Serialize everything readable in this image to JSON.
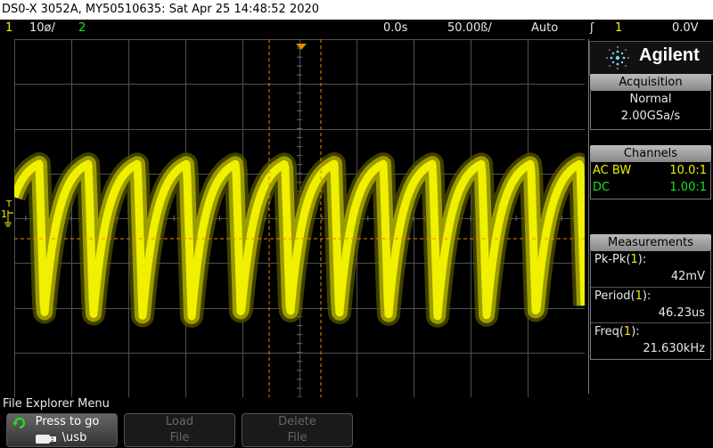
{
  "title": "DS0-X 3052A, MY50510635: Sat Apr 25 14:48:52 2020",
  "status": {
    "ch1_num": "1",
    "ch1_scale": "10ø/",
    "ch2_num": "2",
    "time_pos": "0.0s",
    "time_scale": "50.00ß/",
    "trig_mode": "Auto",
    "trig_icon": "ʃ",
    "trig_src": "1",
    "trig_level": "0.0V"
  },
  "screen": {
    "ch1_label": "1",
    "trig_t": "T",
    "colors": {
      "ch1": "#f0f000",
      "ch2": "#19e619",
      "cursor": "#e68a00",
      "grid": "#505050"
    }
  },
  "side": {
    "brand": "Agilent",
    "acquisition": {
      "header": "Acquisition",
      "mode": "Normal",
      "rate": "2.00GSa/s"
    },
    "channels": {
      "header": "Channels",
      "ch1_coupling": "AC BW",
      "ch1_probe": "10.0:1",
      "ch2_coupling": "DC",
      "ch2_probe": "1.00:1"
    },
    "measurements": {
      "header": "Measurements",
      "items": [
        {
          "name": "Pk-Pk",
          "src": "1",
          "value": "42mV"
        },
        {
          "name": "Period",
          "src": "1",
          "value": "46.23us"
        },
        {
          "name": "Freq",
          "src": "1",
          "value": "21.630kHz"
        }
      ]
    }
  },
  "menu": {
    "title": "File Explorer Menu",
    "keys": [
      {
        "line1": "Press to go",
        "line2": "\\usb"
      },
      {
        "line1": "Load",
        "line2": "File"
      },
      {
        "line1": "Delete",
        "line2": "File"
      }
    ]
  },
  "icons": {
    "knob": "rotate-knob-icon",
    "usb": "usb-icon",
    "logo": "agilent-spark-icon"
  }
}
